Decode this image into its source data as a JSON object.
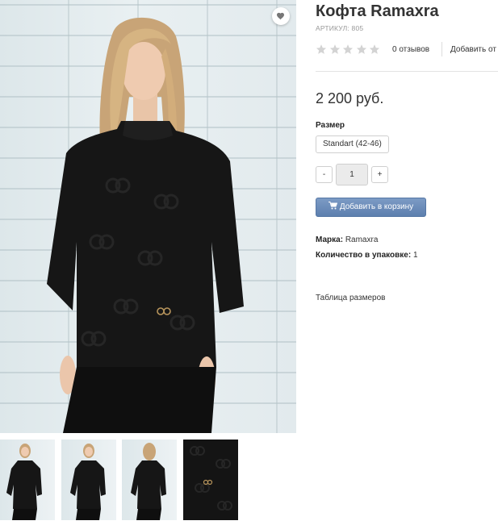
{
  "product": {
    "title": "Кофта Ramaxra",
    "sku": "АРТИКУЛ: 805",
    "reviews": "0 отзывов",
    "add_link": "Добавить от",
    "price": "2 200 руб.",
    "size_label": "Размер",
    "size_option": "Standart (42-46)",
    "qty_minus": "-",
    "qty_value": "1",
    "qty_plus": "+",
    "cart_button": "Добавить в корзину",
    "brand_label": "Марка:",
    "brand_value": "Ramaxra",
    "pack_label": "Количество в упаковке:",
    "pack_value": "1",
    "size_table_link": "Таблица размеров"
  },
  "rating": {
    "stars_filled": 0,
    "stars_total": 5
  },
  "icons": {
    "favorite": "heart-icon",
    "cart": "cart-icon",
    "star": "star-icon"
  },
  "colors": {
    "accent": "#6584b2",
    "star_empty": "#d3d3d3",
    "text": "#333333"
  }
}
